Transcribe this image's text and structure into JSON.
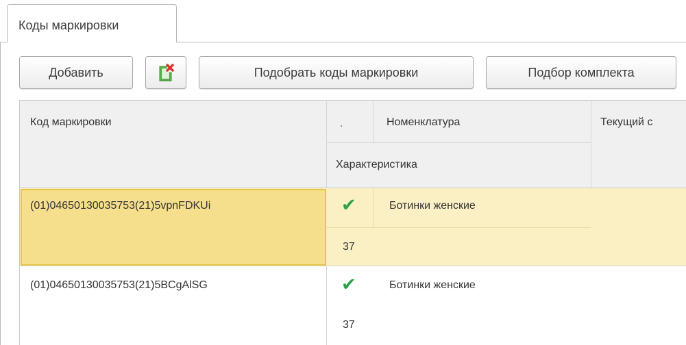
{
  "tab": {
    "label": "Коды маркировки"
  },
  "toolbar": {
    "add_label": "Добавить",
    "delete_icon": "delete-document-icon",
    "pick_codes_label": "Подобрать коды маркировки",
    "pick_kit_label": "Подбор комплекта"
  },
  "table": {
    "headers": {
      "code": "Код маркировки",
      "mark": ".",
      "nomenclature": "Номенклатура",
      "characteristic": "Характеристика",
      "current_status": "Текущий с"
    },
    "rows": [
      {
        "code": "(01)04650130035753(21)5vpnFDKUi",
        "check": "✔",
        "nomenclature": "Ботинки женские",
        "characteristic": "37",
        "selected": true
      },
      {
        "code": "(01)04650130035753(21)5BCgAlSG",
        "check": "✔",
        "nomenclature": "Ботинки женские",
        "characteristic": "37",
        "selected": false
      }
    ]
  },
  "colors": {
    "selected_row": "#fbf0c4",
    "selected_cell": "#f5df8c",
    "check": "#2aa14a",
    "header_bg": "#f0f0f0"
  }
}
